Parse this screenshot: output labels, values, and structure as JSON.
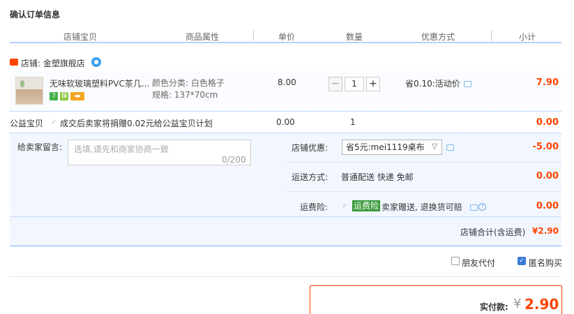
{
  "section_title": "确认订单信息",
  "headers": [
    "店铺宝贝",
    "商品属性",
    "单价",
    "数量",
    "优惠方式",
    "小计"
  ],
  "store": {
    "name": "店铺: 金塑旗舰店"
  },
  "item": {
    "title": "无味软玻璃塑料PVC茶几...",
    "color_attr": "颜色分类: 白色格子",
    "size_attr": "规格: 137*70cm",
    "price": "8.00",
    "quantity": "1",
    "minus": "−",
    "plus": "+",
    "discount": "省0.10:活动价",
    "subtotal": "7.90"
  },
  "charity": {
    "label": "公益宝贝",
    "text": "成交后卖家将捐赠0.02元给公益宝贝计划",
    "price": "0.00",
    "qty": "1",
    "total": "0.00"
  },
  "message": {
    "label": "给卖家留言:",
    "placeholder": "选填,请先和商家协商一致",
    "count": "0/200"
  },
  "shop_discount": {
    "label": "店铺优惠:",
    "selected": "省5元:mei1119桌布",
    "value": "-5.00"
  },
  "shipping": {
    "label": "运送方式:",
    "value": "普通配送 快递 免邮",
    "price": "0.00"
  },
  "insurance": {
    "label": "运费险:",
    "badge": "运费险",
    "text": "卖家赠送, 退换货可赔",
    "price": "0.00"
  },
  "shop_total": {
    "label": "店铺合计(含运费)",
    "value": "¥2.90"
  },
  "options": {
    "friend_pay": "朋友代付",
    "anonymous": "匿名购买"
  },
  "payment": {
    "label": "实付款:",
    "yen": "¥",
    "amount": "2.90"
  },
  "colors": {
    "accent_red": "#ff4400",
    "header_line": "#b2d1ff",
    "panel_bg": "#f2f7ff"
  }
}
